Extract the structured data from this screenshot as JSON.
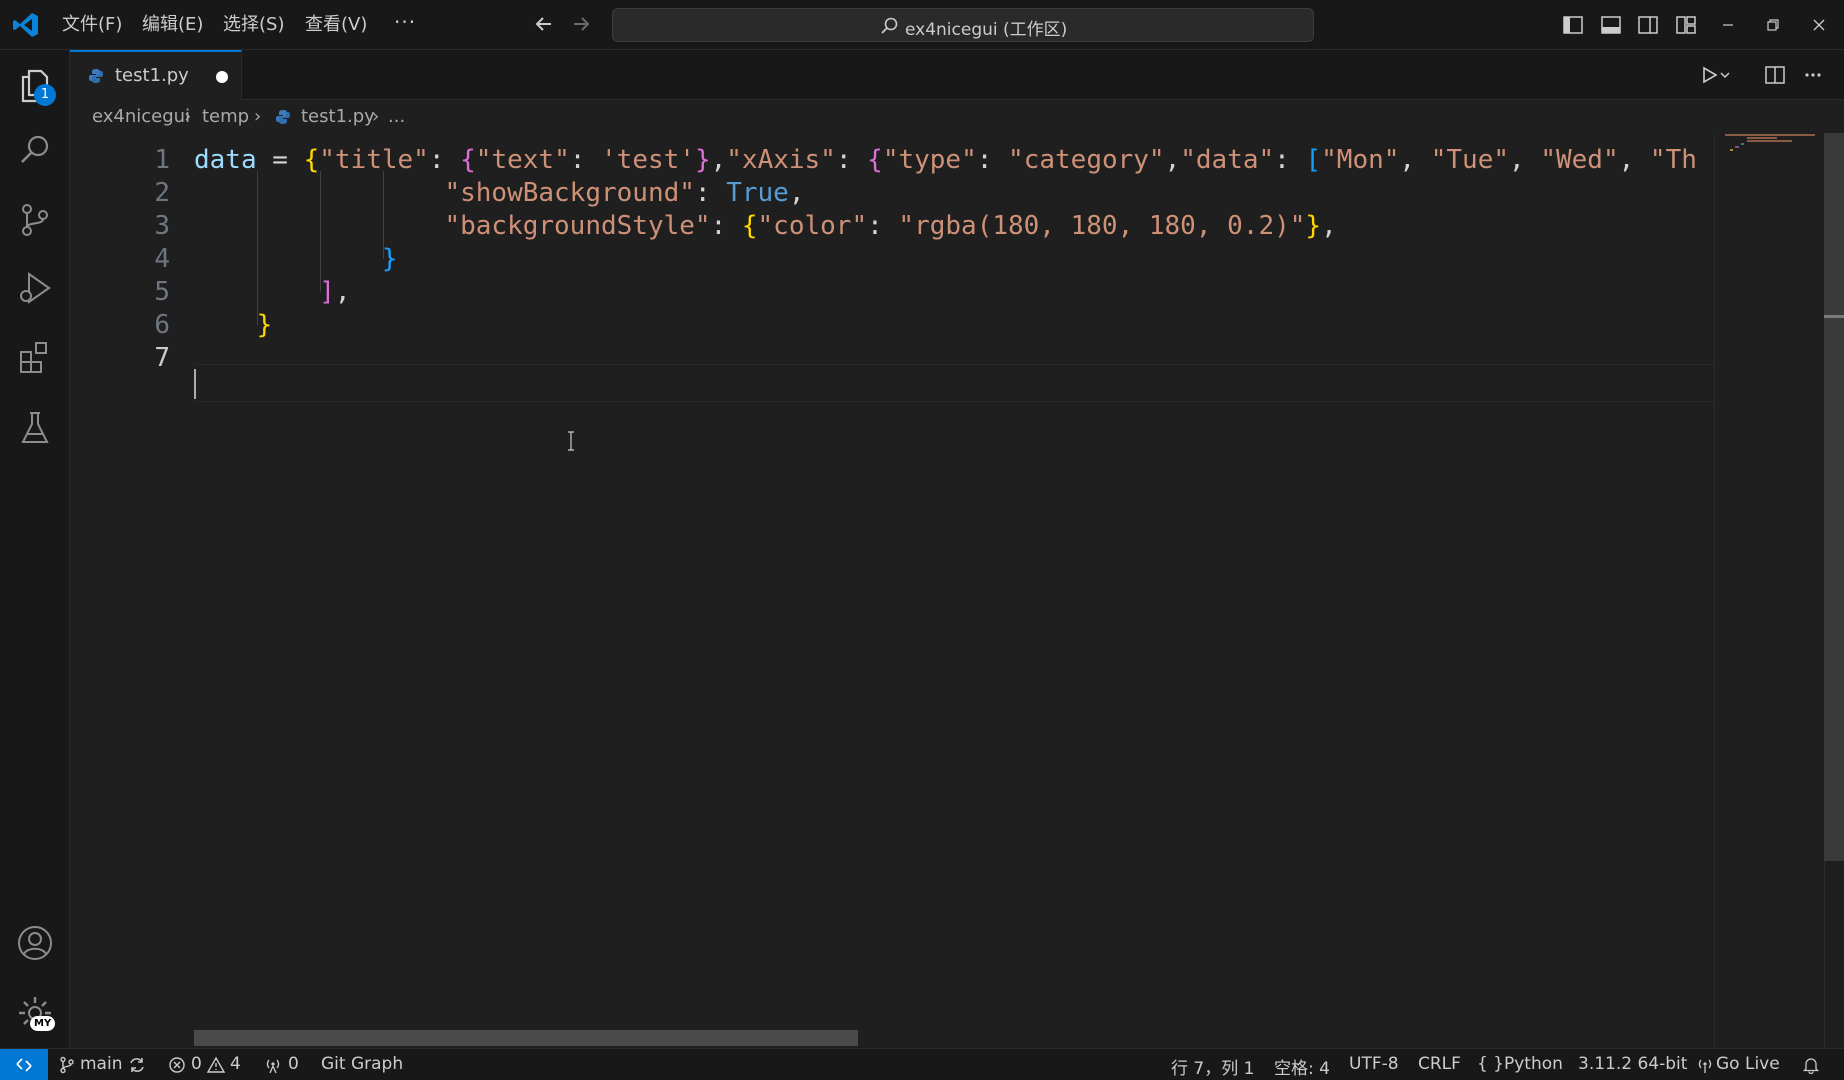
{
  "menu": {
    "file": "文件(F)",
    "edit": "编辑(E)",
    "selection": "选择(S)",
    "view": "查看(V)",
    "more": "···"
  },
  "command_center": {
    "text": "ex4nicegui (工作区)"
  },
  "activity": {
    "explorer_badge": "1",
    "manage_badge": "MY"
  },
  "tab": {
    "label": "test1.py"
  },
  "breadcrumb": [
    "ex4nicegui",
    "temp",
    "test1.py",
    "..."
  ],
  "editor": {
    "line_numbers": [
      "1",
      "2",
      "3",
      "4",
      "5",
      "6",
      "7"
    ],
    "active_line": 7,
    "lines": [
      [
        {
          "t": "data",
          "c": "#9cdcfe"
        },
        {
          "t": " = ",
          "c": "#d4d4d4"
        },
        {
          "t": "{",
          "c": "#ffd700"
        },
        {
          "t": "\"title\"",
          "c": "#ce9178"
        },
        {
          "t": ": ",
          "c": "#d4d4d4"
        },
        {
          "t": "{",
          "c": "#da70d6"
        },
        {
          "t": "\"text\"",
          "c": "#ce9178"
        },
        {
          "t": ": ",
          "c": "#d4d4d4"
        },
        {
          "t": "'test'",
          "c": "#ce9178"
        },
        {
          "t": "}",
          "c": "#da70d6"
        },
        {
          "t": ",",
          "c": "#d4d4d4"
        },
        {
          "t": "\"xAxis\"",
          "c": "#ce9178"
        },
        {
          "t": ": ",
          "c": "#d4d4d4"
        },
        {
          "t": "{",
          "c": "#da70d6"
        },
        {
          "t": "\"type\"",
          "c": "#ce9178"
        },
        {
          "t": ": ",
          "c": "#d4d4d4"
        },
        {
          "t": "\"category\"",
          "c": "#ce9178"
        },
        {
          "t": ",",
          "c": "#d4d4d4"
        },
        {
          "t": "\"data\"",
          "c": "#ce9178"
        },
        {
          "t": ": ",
          "c": "#d4d4d4"
        },
        {
          "t": "[",
          "c": "#179fff"
        },
        {
          "t": "\"Mon\"",
          "c": "#ce9178"
        },
        {
          "t": ", ",
          "c": "#d4d4d4"
        },
        {
          "t": "\"Tue\"",
          "c": "#ce9178"
        },
        {
          "t": ", ",
          "c": "#d4d4d4"
        },
        {
          "t": "\"Wed\"",
          "c": "#ce9178"
        },
        {
          "t": ", ",
          "c": "#d4d4d4"
        },
        {
          "t": "\"Th",
          "c": "#ce9178"
        }
      ],
      [
        {
          "t": "                ",
          "c": "#d4d4d4"
        },
        {
          "t": "\"showBackground\"",
          "c": "#ce9178"
        },
        {
          "t": ": ",
          "c": "#d4d4d4"
        },
        {
          "t": "True",
          "c": "#569cd6"
        },
        {
          "t": ",",
          "c": "#d4d4d4"
        }
      ],
      [
        {
          "t": "                ",
          "c": "#d4d4d4"
        },
        {
          "t": "\"backgroundStyle\"",
          "c": "#ce9178"
        },
        {
          "t": ": ",
          "c": "#d4d4d4"
        },
        {
          "t": "{",
          "c": "#ffd700"
        },
        {
          "t": "\"color\"",
          "c": "#ce9178"
        },
        {
          "t": ": ",
          "c": "#d4d4d4"
        },
        {
          "t": "\"rgba(180, 180, 180, 0.2)\"",
          "c": "#ce9178"
        },
        {
          "t": "}",
          "c": "#ffd700"
        },
        {
          "t": ",",
          "c": "#d4d4d4"
        }
      ],
      [
        {
          "t": "            ",
          "c": "#d4d4d4"
        },
        {
          "t": "}",
          "c": "#179fff"
        }
      ],
      [
        {
          "t": "        ",
          "c": "#d4d4d4"
        },
        {
          "t": "]",
          "c": "#da70d6"
        },
        {
          "t": ",",
          "c": "#d4d4d4"
        }
      ],
      [
        {
          "t": "    ",
          "c": "#d4d4d4"
        },
        {
          "t": "}",
          "c": "#ffd700"
        }
      ],
      []
    ]
  },
  "status": {
    "branch": "main",
    "errors": "0",
    "warnings": "4",
    "ports": "0",
    "git_graph": "Git Graph",
    "position": "行 7，列 1",
    "spaces": "空格: 4",
    "encoding": "UTF-8",
    "eol": "CRLF",
    "language": "Python",
    "interpreter": "3.11.2 64-bit",
    "go_live": "Go Live"
  },
  "colors": {
    "accent": "#0078d4",
    "background": "#1f1f1f",
    "chrome": "#181818"
  }
}
